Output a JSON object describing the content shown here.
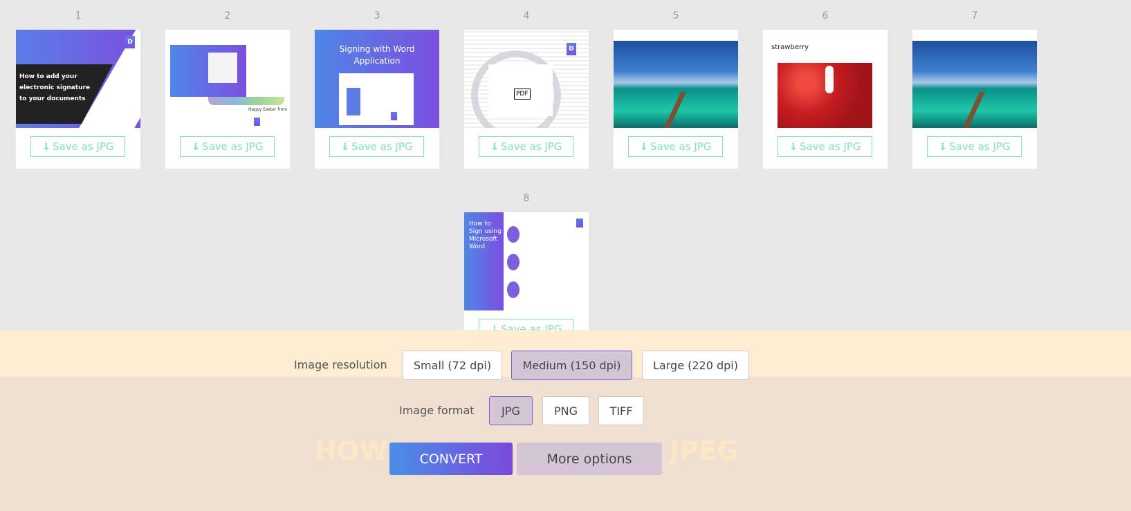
{
  "pages": [
    {
      "number": "1",
      "save_label": "Save as JPG",
      "caption": "How to add your electronic signature to your documents"
    },
    {
      "number": "2",
      "save_label": "Save as JPG",
      "caption": "Happy Easter from"
    },
    {
      "number": "3",
      "save_label": "Save as JPG",
      "caption": "Signing with Word Application"
    },
    {
      "number": "4",
      "save_label": "Save as JPG",
      "caption": "PDF"
    },
    {
      "number": "5",
      "save_label": "Save as JPG"
    },
    {
      "number": "6",
      "save_label": "Save as JPG",
      "caption": "strawberry"
    },
    {
      "number": "7",
      "save_label": "Save as JPG"
    },
    {
      "number": "8",
      "save_label": "Save as JPG",
      "caption": "How to Sign using Microsoft Word"
    }
  ],
  "logo_letter": "D",
  "background_heading": {
    "left": "HOW",
    "right": "JPEG"
  },
  "resolution": {
    "label": "Image resolution",
    "options": [
      "Small (72 dpi)",
      "Medium (150 dpi)",
      "Large (220 dpi)"
    ],
    "selected": "Medium (150 dpi)"
  },
  "format": {
    "label": "Image format",
    "options": [
      "JPG",
      "PNG",
      "TIFF"
    ],
    "selected": "JPG"
  },
  "actions": {
    "convert": "CONVERT",
    "more": "More options"
  },
  "colors": {
    "accent": "#7b4fe0",
    "save_border": "#7fe0c3",
    "selected_bg": "#d3c4d6"
  }
}
